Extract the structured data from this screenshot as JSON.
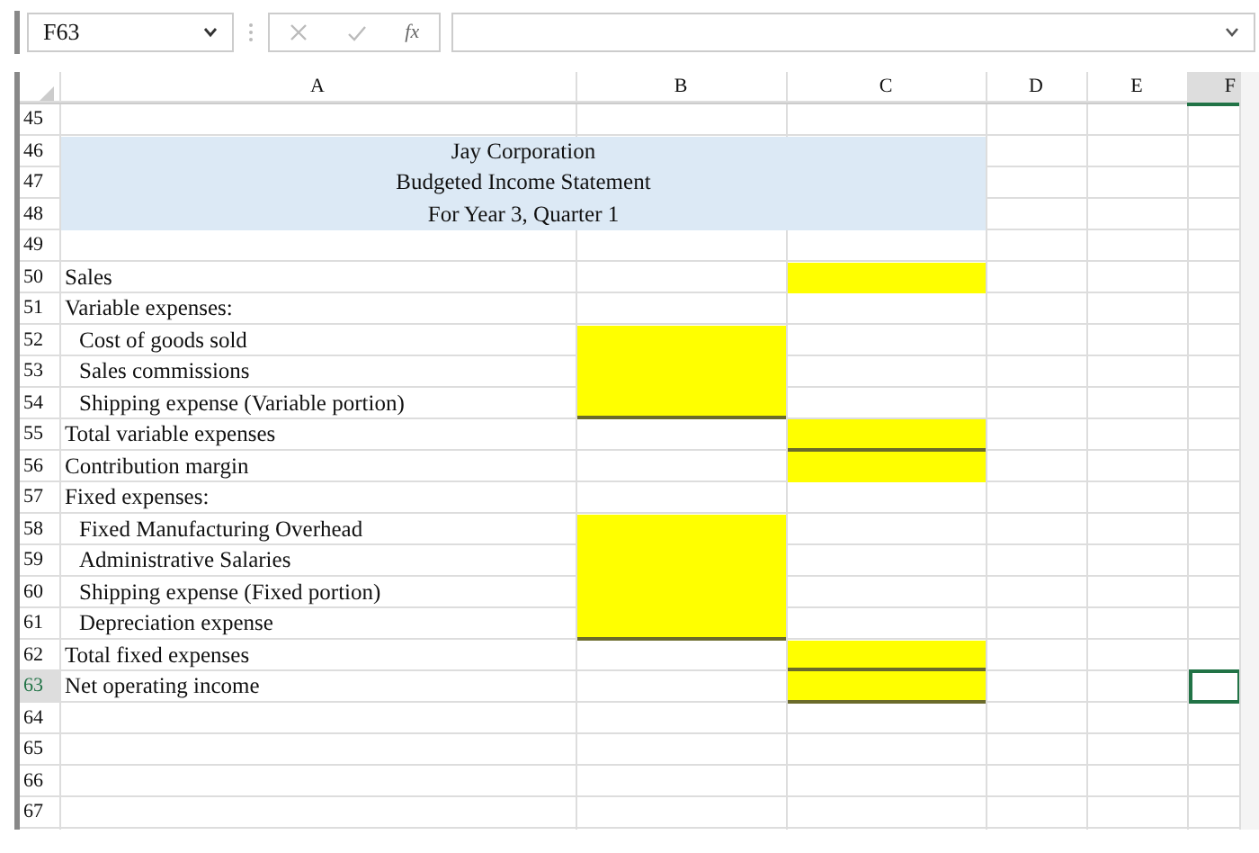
{
  "formula_bar": {
    "name_box": "F63",
    "function_label": "fx"
  },
  "columns": [
    {
      "label": "A",
      "selected": false
    },
    {
      "label": "B",
      "selected": false
    },
    {
      "label": "C",
      "selected": false
    },
    {
      "label": "D",
      "selected": false
    },
    {
      "label": "E",
      "selected": false
    },
    {
      "label": "F",
      "selected": true
    }
  ],
  "rows": [
    {
      "row": "45",
      "kind": "blank",
      "selected": false
    },
    {
      "row": "46",
      "kind": "title",
      "text": "Jay Corporation",
      "selected": false
    },
    {
      "row": "47",
      "kind": "title",
      "text": "Budgeted Income Statement",
      "selected": false
    },
    {
      "row": "48",
      "kind": "title",
      "text": "For Year 3, Quarter 1",
      "selected": false
    },
    {
      "row": "49",
      "kind": "blank",
      "selected": false
    },
    {
      "row": "50",
      "kind": "line",
      "text": "Sales",
      "selected": false,
      "b": {
        "filled": false,
        "underlined": false
      },
      "c": {
        "filled": true,
        "underlined": false
      }
    },
    {
      "row": "51",
      "kind": "line",
      "text": "Variable expenses:",
      "selected": false,
      "b": {
        "filled": false,
        "underlined": false
      },
      "c": {
        "filled": false,
        "underlined": false
      }
    },
    {
      "row": "52",
      "kind": "item",
      "text": "Cost of goods sold",
      "selected": false,
      "b": {
        "filled": true,
        "underlined": false
      },
      "c": {
        "filled": false,
        "underlined": false
      }
    },
    {
      "row": "53",
      "kind": "item",
      "text": "Sales commissions",
      "selected": false,
      "b": {
        "filled": true,
        "underlined": false
      },
      "c": {
        "filled": false,
        "underlined": false
      }
    },
    {
      "row": "54",
      "kind": "item",
      "text": "Shipping expense (Variable portion)",
      "selected": false,
      "b": {
        "filled": true,
        "underlined": true
      },
      "c": {
        "filled": false,
        "underlined": false
      }
    },
    {
      "row": "55",
      "kind": "line",
      "text": "Total variable expenses",
      "selected": false,
      "b": {
        "filled": false,
        "underlined": false
      },
      "c": {
        "filled": true,
        "underlined": true
      }
    },
    {
      "row": "56",
      "kind": "line",
      "text": "Contribution margin",
      "selected": false,
      "b": {
        "filled": false,
        "underlined": false
      },
      "c": {
        "filled": true,
        "underlined": false
      }
    },
    {
      "row": "57",
      "kind": "line",
      "text": "Fixed expenses:",
      "selected": false,
      "b": {
        "filled": false,
        "underlined": false
      },
      "c": {
        "filled": false,
        "underlined": false
      }
    },
    {
      "row": "58",
      "kind": "item",
      "text": "Fixed Manufacturing Overhead",
      "selected": false,
      "b": {
        "filled": true,
        "underlined": false
      },
      "c": {
        "filled": false,
        "underlined": false
      }
    },
    {
      "row": "59",
      "kind": "item",
      "text": "Administrative Salaries",
      "selected": false,
      "b": {
        "filled": true,
        "underlined": false
      },
      "c": {
        "filled": false,
        "underlined": false
      }
    },
    {
      "row": "60",
      "kind": "item",
      "text": "Shipping expense (Fixed portion)",
      "selected": false,
      "b": {
        "filled": true,
        "underlined": false
      },
      "c": {
        "filled": false,
        "underlined": false
      }
    },
    {
      "row": "61",
      "kind": "item",
      "text": "Depreciation expense",
      "selected": false,
      "b": {
        "filled": true,
        "underlined": true
      },
      "c": {
        "filled": false,
        "underlined": false
      }
    },
    {
      "row": "62",
      "kind": "line",
      "text": "Total fixed expenses",
      "selected": false,
      "b": {
        "filled": false,
        "underlined": false
      },
      "c": {
        "filled": true,
        "underlined": true
      }
    },
    {
      "row": "63",
      "kind": "line",
      "text": "Net operating income",
      "selected": true,
      "b": {
        "filled": false,
        "underlined": false
      },
      "c": {
        "filled": true,
        "underlined": true
      }
    },
    {
      "row": "64",
      "kind": "blank",
      "selected": false
    },
    {
      "row": "65",
      "kind": "blank",
      "selected": false
    },
    {
      "row": "66",
      "kind": "blank",
      "selected": false
    },
    {
      "row": "67",
      "kind": "blank",
      "selected": false
    }
  ]
}
